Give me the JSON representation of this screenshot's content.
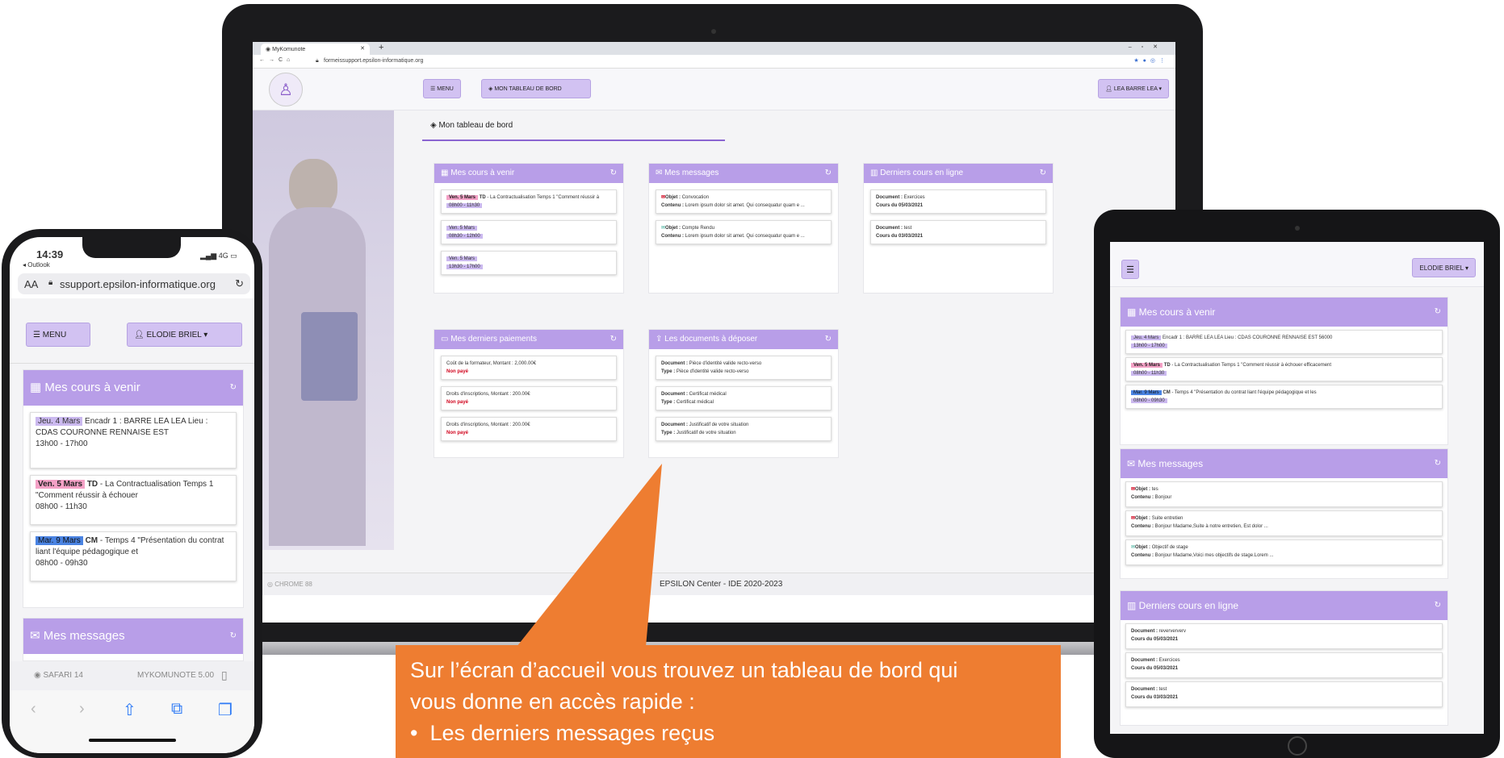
{
  "laptop": {
    "tab_title": "MyKomunote",
    "url": "formeissupport.epsilon-informatique.org",
    "menu_label": "MENU",
    "dashboard_btn": "MON TABLEAU DE BORD",
    "user_btn": "LEA BARRE LEA",
    "page_title": "Mon tableau de bord",
    "footer_left": "CHROME 88",
    "footer_center": "EPSILON Center - IDE 2020-2023",
    "cours": {
      "title": "Mes cours à venir",
      "items": [
        {
          "date": "Ven. 5 Mars",
          "time": "08h00 - 11h30",
          "kind": "TD",
          "text": " - La Contractualisation Temps 1 \"Comment réussir à"
        },
        {
          "date": "Ven. 5 Mars",
          "time": "08h30 - 12h00",
          "kind": "",
          "text": ""
        },
        {
          "date": "Ven. 5 Mars",
          "time": "13h30 - 17h00",
          "kind": "",
          "text": ""
        }
      ]
    },
    "messages": {
      "title": "Mes messages",
      "items": [
        {
          "objet": "Convocation",
          "contenu": "Lorem ipsum dolor sit amet. Qui consequatur quam e ..."
        },
        {
          "objet": "Compte Rendu",
          "contenu": "Lorem ipsum dolor sit amet. Qui consequatur quam e ..."
        }
      ]
    },
    "derniers": {
      "title": "Derniers cours en ligne",
      "items": [
        {
          "doc": "Exercices",
          "cours": "Cours du 05/03/2021"
        },
        {
          "doc": "test",
          "cours": "Cours du 03/03/2021"
        }
      ]
    },
    "paiements": {
      "title": "Mes derniers paiements",
      "items": [
        {
          "label": "Coût de la formateur, Montant : 2,000.00€",
          "status": "Non payé"
        },
        {
          "label": "Droits d'inscriptions, Montant : 200.00€",
          "status": "Non payé"
        },
        {
          "label": "Droits d'inscriptions, Montant : 200.00€",
          "status": "Non payé"
        }
      ]
    },
    "documents": {
      "title": "Les documents à déposer",
      "items": [
        {
          "doc": "Pièce d'identité valide recto-verso",
          "type": "Pièce d'identité valide recto-verso"
        },
        {
          "doc": "Certificat médical",
          "type": "Certificat médical"
        },
        {
          "doc": "Justificatif de votre situation",
          "type": "Justificatif de votre situation"
        }
      ]
    },
    "labels": {
      "objet": "Objet : ",
      "contenu": "Contenu : ",
      "document": "Document : ",
      "type": "Type : "
    }
  },
  "phone": {
    "time": "14:39",
    "back": "◂ Outlook",
    "signal": "4G",
    "text_size": "AA",
    "url": "ssupport.epsilon-informatique.org",
    "menu_label": "MENU",
    "user_btn": "ELODIE BRIEL",
    "cours_title": "Mes cours à venir",
    "cours": [
      {
        "date": "Jeu. 4 Mars",
        "time": "13h00 - 17h00",
        "kind": "",
        "text": "Encadr 1 : BARRE LEA LEA Lieu : CDAS COURONNE RENNAISE EST"
      },
      {
        "date": "Ven. 5 Mars",
        "time": "08h00 - 11h30",
        "kind": "TD",
        "text": " - La Contractualisation Temps 1 \"Comment réussir à échouer"
      },
      {
        "date": "Mar. 9 Mars",
        "time": "08h00 - 09h30",
        "kind": "CM",
        "text": " - Temps 4 \"Présentation du contrat liant l'équipe pédagogique et"
      }
    ],
    "messages_title": "Mes messages",
    "footer_left": "SAFARI 14",
    "footer_right": "MYKOMUNOTE 5.00"
  },
  "tablet": {
    "user_btn": "ELODIE BRIEL",
    "cours_title": "Mes cours à venir",
    "cours": [
      {
        "date": "Jeu. 4 Mars",
        "time": "13h00 - 17h00",
        "kind": "",
        "text": "Encadr 1 : BARRE LEA LEA Lieu : CDAS COURONNE RENNAISE EST 56000"
      },
      {
        "date": "Ven. 5 Mars",
        "time": "08h00 - 11h30",
        "kind": "TD",
        "text": " - La Contractualisation Temps 1 \"Comment réussir à échouer efficacement"
      },
      {
        "date": "Mar. 9 Mars",
        "time": "08h00 - 09h30",
        "kind": "CM",
        "text": " - Temps 4 \"Présentation du contrat liant l'équipe pédagogique et les"
      }
    ],
    "messages_title": "Mes messages",
    "messages": [
      {
        "objet": "tes",
        "contenu": "Bonjour"
      },
      {
        "objet": "Suite entretien",
        "contenu": "Bonjour Madame,Suite à notre entretien, Est dolor ..."
      },
      {
        "objet": "Objectif de stage",
        "contenu": "Bonjour Madame,Voici mes objectifs de stage.Lorem ..."
      }
    ],
    "derniers_title": "Derniers cours en ligne",
    "derniers": [
      {
        "doc": "reverververv",
        "cours": "Cours du 05/03/2021"
      },
      {
        "doc": "Exercices",
        "cours": "Cours du 05/03/2021"
      },
      {
        "doc": "test",
        "cours": "Cours du 03/03/2021"
      }
    ]
  },
  "callout": {
    "line1": "Sur l’écran d’accueil vous trouvez un tableau de bord qui",
    "line2": "vous donne en accès rapide :",
    "bullet1": "Les derniers messages reçus"
  },
  "colors": {
    "accent": "#b89ee8",
    "callout": "#ee7d31"
  }
}
